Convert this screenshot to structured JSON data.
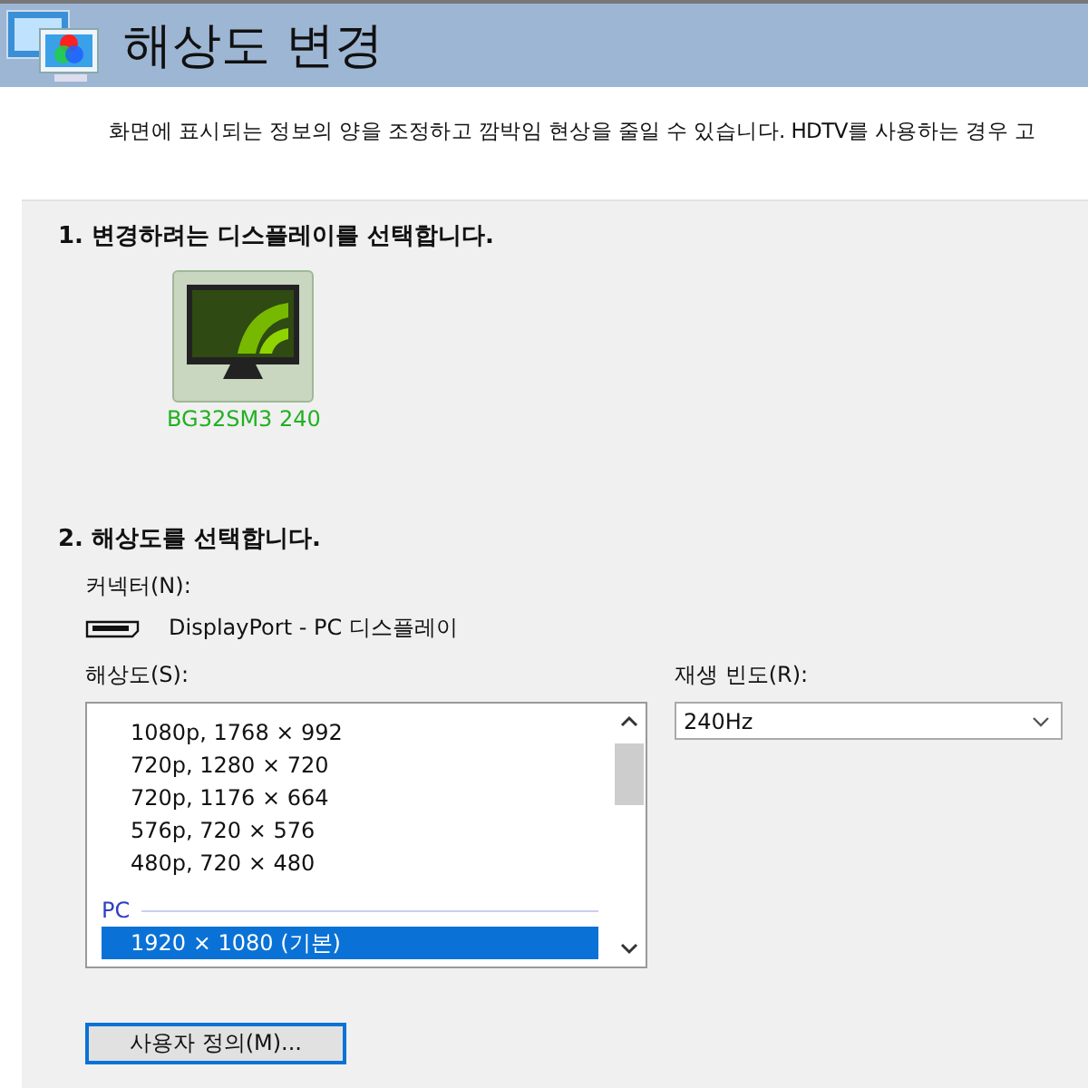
{
  "header": {
    "title": "해상도 변경"
  },
  "description": "화면에 표시되는 정보의 양을 조정하고 깜박임 현상을 줄일 수 있습니다. HDTV를 사용하는 경우 고",
  "section1": {
    "heading": "1. 변경하려는 디스플레이를 선택합니다.",
    "displays": [
      {
        "name": "BG32SM3 240",
        "selected": true
      }
    ]
  },
  "section2": {
    "heading": "2. 해상도를 선택합니다.",
    "connector": {
      "label": "커넥터(N):",
      "value": "DisplayPort - PC 디스플레이"
    },
    "resolution": {
      "label": "해상도(S):",
      "items": [
        {
          "kind": "item",
          "text": "1080p, 1768 × 992",
          "selected": false
        },
        {
          "kind": "item",
          "text": "720p, 1280 × 720",
          "selected": false
        },
        {
          "kind": "item",
          "text": "720p, 1176 × 664",
          "selected": false
        },
        {
          "kind": "item",
          "text": "576p, 720 × 576",
          "selected": false
        },
        {
          "kind": "item",
          "text": "480p, 720 × 480",
          "selected": false
        },
        {
          "kind": "group",
          "text": "PC"
        },
        {
          "kind": "item",
          "text": "1920 × 1080 (기본)",
          "selected": true
        }
      ]
    },
    "refresh": {
      "label": "재생 빈도(R):",
      "value": "240Hz"
    },
    "custom_button": "사용자 정의(M)..."
  }
}
